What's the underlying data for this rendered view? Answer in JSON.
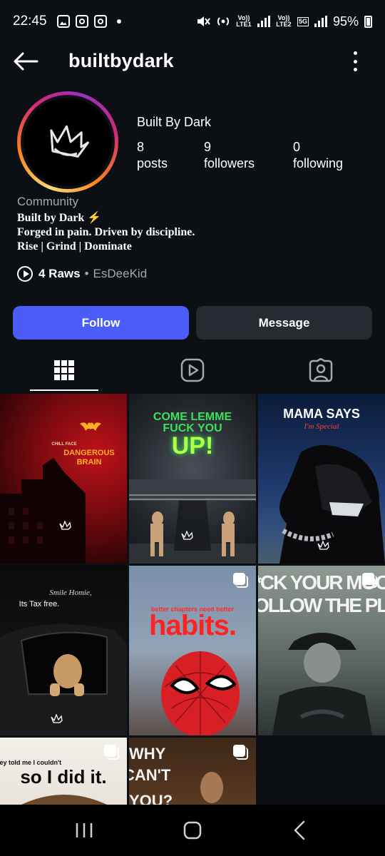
{
  "status_bar": {
    "time": "22:45",
    "battery": "95%",
    "volte1": "Vo)) LTE1",
    "volte2": "Vo)) LTE2",
    "network": "5G"
  },
  "app_bar": {
    "username": "builtbydark"
  },
  "profile": {
    "display_name": "Built By Dark",
    "stats": [
      {
        "value": "8",
        "label": "posts"
      },
      {
        "value": "9",
        "label": "followers"
      },
      {
        "value": "0",
        "label": "following"
      }
    ],
    "category": "Community",
    "bio_lines": [
      "Built by Dark ⚡",
      "Forged in pain. Driven by discipline.",
      "Rise | Grind | Dominate"
    ],
    "raws_count": "4 Raws",
    "raws_separator": "•",
    "raws_author": "EsDeeKid"
  },
  "actions": {
    "follow_label": "Follow",
    "message_label": "Message"
  },
  "tabs": [
    {
      "icon": "grid-icon",
      "active": true
    },
    {
      "icon": "reels-icon",
      "active": false
    },
    {
      "icon": "tagged-icon",
      "active": false
    }
  ],
  "posts": [
    {
      "line1": "CHILL FACE",
      "line2": "DANGEROUS",
      "line3": "BRAIN",
      "carousel": false
    },
    {
      "line1": "COME LEMME",
      "line2": "FUCK YOU",
      "line3": "UP!",
      "carousel": false
    },
    {
      "line1": "MAMA SAYS",
      "line2": "I'm Special",
      "carousel": false
    },
    {
      "line1": "Smile Homie,",
      "line2": "Its Tax free.",
      "carousel": false
    },
    {
      "line1": "better chapters need better",
      "line2": "habits.",
      "carousel": true
    },
    {
      "line1": "*CK YOUR MOOD",
      "line2": "OLLOW THE PLAN",
      "carousel": true
    },
    {
      "line1": "ney told me I couldn't",
      "line2": "so I did it.",
      "carousel": true
    },
    {
      "line1": "WHY",
      "line2": "CAN'T",
      "line3": "YOU?",
      "carousel": true
    }
  ],
  "colors": {
    "background": "#0c1014",
    "follow_button": "#4a5df9",
    "message_button": "#262a31",
    "muted_text": "#a8a8a8"
  }
}
